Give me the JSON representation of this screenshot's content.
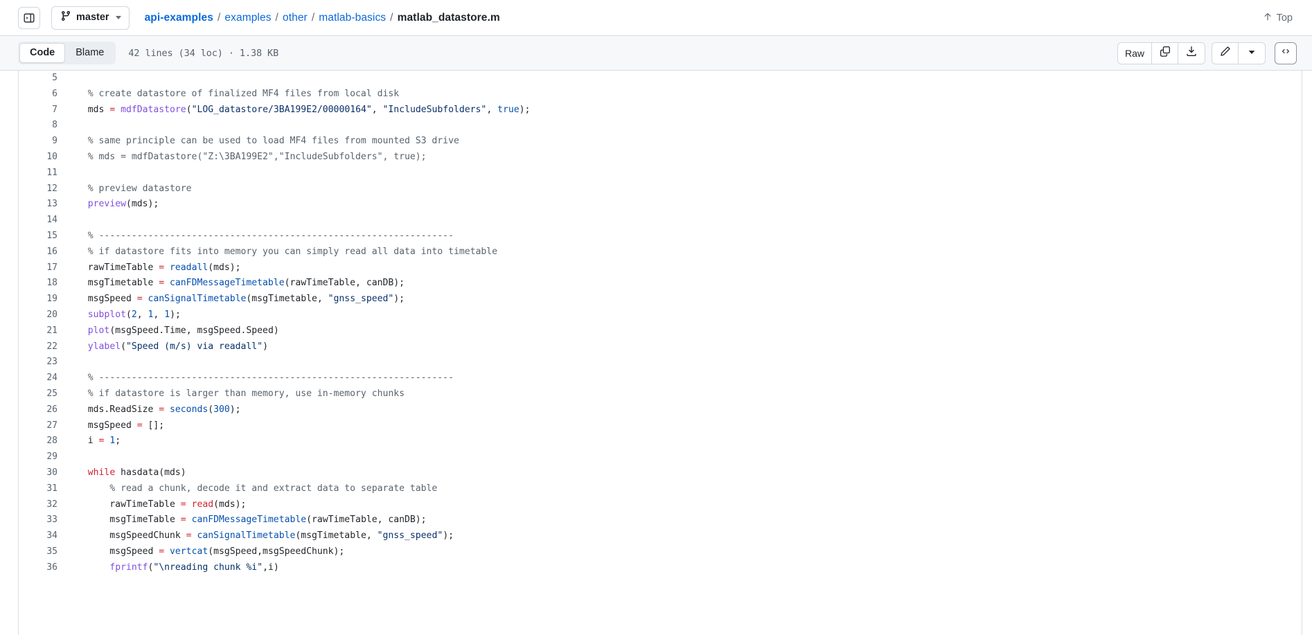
{
  "header": {
    "sidebar_toggle_icon": "sidebar-expand-icon",
    "branch": {
      "icon": "git-branch-icon",
      "name": "master",
      "caret_icon": "chevron-down-icon"
    },
    "breadcrumb": {
      "parts": [
        {
          "label": "api-examples",
          "link": true,
          "bold": true
        },
        {
          "label": "examples",
          "link": true,
          "bold": false
        },
        {
          "label": "other",
          "link": true,
          "bold": false
        },
        {
          "label": "matlab-basics",
          "link": true,
          "bold": false
        }
      ],
      "separator": "/",
      "current": "matlab_datastore.m"
    },
    "top_link": {
      "icon": "arrow-up-icon",
      "label": "Top"
    }
  },
  "toolbar": {
    "tabs": [
      {
        "label": "Code",
        "active": true
      },
      {
        "label": "Blame",
        "active": false
      }
    ],
    "file_meta": "42 lines (34 loc) · 1.38 KB",
    "raw_label": "Raw",
    "copy_icon": "copy-icon",
    "download_icon": "download-icon",
    "edit_icon": "pencil-icon",
    "edit_caret_icon": "chevron-down-icon",
    "symbols_icon": "code-brackets-icon"
  },
  "colors": {
    "link": "#0969da",
    "comment": "#59636e",
    "function_purple": "#8250df",
    "function_blue": "#0550ae",
    "string": "#0a3069",
    "keyword": "#cf222e",
    "border": "#d8dee4",
    "toolbar_bg": "#f6f8fa"
  },
  "code": {
    "language": "matlab",
    "first_visible_line": 5,
    "lines": [
      {
        "n": 5,
        "tokens": []
      },
      {
        "n": 6,
        "tokens": [
          {
            "t": "  ",
            "c": "pun"
          },
          {
            "t": "% create datastore of finalized MF4 files from local disk",
            "c": "com"
          }
        ]
      },
      {
        "n": 7,
        "tokens": [
          {
            "t": "  mds ",
            "c": "id"
          },
          {
            "t": "=",
            "c": "op"
          },
          {
            "t": " ",
            "c": "id"
          },
          {
            "t": "mdfDatastore",
            "c": "fn"
          },
          {
            "t": "(",
            "c": "pun"
          },
          {
            "t": "\"LOG_datastore/3BA199E2/00000164\"",
            "c": "str"
          },
          {
            "t": ", ",
            "c": "pun"
          },
          {
            "t": "\"IncludeSubfolders\"",
            "c": "str"
          },
          {
            "t": ", ",
            "c": "pun"
          },
          {
            "t": "true",
            "c": "bool"
          },
          {
            "t": ");",
            "c": "pun"
          }
        ]
      },
      {
        "n": 8,
        "tokens": []
      },
      {
        "n": 9,
        "tokens": [
          {
            "t": "  ",
            "c": "pun"
          },
          {
            "t": "% same principle can be used to load MF4 files from mounted S3 drive",
            "c": "com"
          }
        ]
      },
      {
        "n": 10,
        "tokens": [
          {
            "t": "  ",
            "c": "pun"
          },
          {
            "t": "% mds = mdfDatastore(\"Z:\\3BA199E2\",\"IncludeSubfolders\", true);",
            "c": "com"
          }
        ]
      },
      {
        "n": 11,
        "tokens": []
      },
      {
        "n": 12,
        "tokens": [
          {
            "t": "  ",
            "c": "pun"
          },
          {
            "t": "% preview datastore",
            "c": "com"
          }
        ]
      },
      {
        "n": 13,
        "tokens": [
          {
            "t": "  ",
            "c": "pun"
          },
          {
            "t": "preview",
            "c": "fn"
          },
          {
            "t": "(mds);",
            "c": "pun"
          }
        ]
      },
      {
        "n": 14,
        "tokens": []
      },
      {
        "n": 15,
        "tokens": [
          {
            "t": "  ",
            "c": "pun"
          },
          {
            "t": "% -----------------------------------------------------------------",
            "c": "com"
          }
        ]
      },
      {
        "n": 16,
        "tokens": [
          {
            "t": "  ",
            "c": "pun"
          },
          {
            "t": "% if datastore fits into memory you can simply read all data into timetable",
            "c": "com"
          }
        ]
      },
      {
        "n": 17,
        "tokens": [
          {
            "t": "  rawTimeTable ",
            "c": "id"
          },
          {
            "t": "=",
            "c": "op"
          },
          {
            "t": " ",
            "c": "id"
          },
          {
            "t": "readall",
            "c": "fn2"
          },
          {
            "t": "(mds);",
            "c": "pun"
          }
        ]
      },
      {
        "n": 18,
        "tokens": [
          {
            "t": "  msgTimetable ",
            "c": "id"
          },
          {
            "t": "=",
            "c": "op"
          },
          {
            "t": " ",
            "c": "id"
          },
          {
            "t": "canFDMessageTimetable",
            "c": "fn2"
          },
          {
            "t": "(rawTimeTable, canDB);",
            "c": "pun"
          }
        ]
      },
      {
        "n": 19,
        "tokens": [
          {
            "t": "  msgSpeed ",
            "c": "id"
          },
          {
            "t": "=",
            "c": "op"
          },
          {
            "t": " ",
            "c": "id"
          },
          {
            "t": "canSignalTimetable",
            "c": "fn2"
          },
          {
            "t": "(msgTimetable, ",
            "c": "pun"
          },
          {
            "t": "\"gnss_speed\"",
            "c": "str"
          },
          {
            "t": ");",
            "c": "pun"
          }
        ]
      },
      {
        "n": 20,
        "tokens": [
          {
            "t": "  ",
            "c": "pun"
          },
          {
            "t": "subplot",
            "c": "fn"
          },
          {
            "t": "(",
            "c": "pun"
          },
          {
            "t": "2",
            "c": "num"
          },
          {
            "t": ", ",
            "c": "pun"
          },
          {
            "t": "1",
            "c": "num"
          },
          {
            "t": ", ",
            "c": "pun"
          },
          {
            "t": "1",
            "c": "num"
          },
          {
            "t": ");",
            "c": "pun"
          }
        ]
      },
      {
        "n": 21,
        "tokens": [
          {
            "t": "  ",
            "c": "pun"
          },
          {
            "t": "plot",
            "c": "fn"
          },
          {
            "t": "(msgSpeed.Time, msgSpeed.Speed)",
            "c": "pun"
          }
        ]
      },
      {
        "n": 22,
        "tokens": [
          {
            "t": "  ",
            "c": "pun"
          },
          {
            "t": "ylabel",
            "c": "fn"
          },
          {
            "t": "(",
            "c": "pun"
          },
          {
            "t": "\"Speed (m/s) via readall\"",
            "c": "str"
          },
          {
            "t": ")",
            "c": "pun"
          }
        ]
      },
      {
        "n": 23,
        "tokens": []
      },
      {
        "n": 24,
        "tokens": [
          {
            "t": "  ",
            "c": "pun"
          },
          {
            "t": "% -----------------------------------------------------------------",
            "c": "com"
          }
        ]
      },
      {
        "n": 25,
        "tokens": [
          {
            "t": "  ",
            "c": "pun"
          },
          {
            "t": "% if datastore is larger than memory, use in-memory chunks",
            "c": "com"
          }
        ]
      },
      {
        "n": 26,
        "tokens": [
          {
            "t": "  mds.ReadSize ",
            "c": "id"
          },
          {
            "t": "=",
            "c": "op"
          },
          {
            "t": " ",
            "c": "id"
          },
          {
            "t": "seconds",
            "c": "fn2"
          },
          {
            "t": "(",
            "c": "pun"
          },
          {
            "t": "300",
            "c": "num"
          },
          {
            "t": ");",
            "c": "pun"
          }
        ]
      },
      {
        "n": 27,
        "tokens": [
          {
            "t": "  msgSpeed ",
            "c": "id"
          },
          {
            "t": "=",
            "c": "op"
          },
          {
            "t": " [];",
            "c": "pun"
          }
        ]
      },
      {
        "n": 28,
        "tokens": [
          {
            "t": "  i ",
            "c": "id"
          },
          {
            "t": "=",
            "c": "op"
          },
          {
            "t": " ",
            "c": "id"
          },
          {
            "t": "1",
            "c": "num"
          },
          {
            "t": ";",
            "c": "pun"
          }
        ]
      },
      {
        "n": 29,
        "tokens": []
      },
      {
        "n": 30,
        "tokens": [
          {
            "t": "  ",
            "c": "pun"
          },
          {
            "t": "while",
            "c": "kw"
          },
          {
            "t": " hasdata(mds)",
            "c": "pun"
          }
        ]
      },
      {
        "n": 31,
        "tokens": [
          {
            "t": "      ",
            "c": "pun"
          },
          {
            "t": "% read a chunk, decode it and extract data to separate table",
            "c": "com"
          }
        ]
      },
      {
        "n": 32,
        "tokens": [
          {
            "t": "      rawTimeTable ",
            "c": "id"
          },
          {
            "t": "=",
            "c": "op"
          },
          {
            "t": " ",
            "c": "id"
          },
          {
            "t": "read",
            "c": "kw"
          },
          {
            "t": "(mds);",
            "c": "pun"
          }
        ]
      },
      {
        "n": 33,
        "tokens": [
          {
            "t": "      msgTimeTable ",
            "c": "id"
          },
          {
            "t": "=",
            "c": "op"
          },
          {
            "t": " ",
            "c": "id"
          },
          {
            "t": "canFDMessageTimetable",
            "c": "fn2"
          },
          {
            "t": "(rawTimeTable, canDB);",
            "c": "pun"
          }
        ]
      },
      {
        "n": 34,
        "tokens": [
          {
            "t": "      msgSpeedChunk ",
            "c": "id"
          },
          {
            "t": "=",
            "c": "op"
          },
          {
            "t": " ",
            "c": "id"
          },
          {
            "t": "canSignalTimetable",
            "c": "fn2"
          },
          {
            "t": "(msgTimetable, ",
            "c": "pun"
          },
          {
            "t": "\"gnss_speed\"",
            "c": "str"
          },
          {
            "t": ");",
            "c": "pun"
          }
        ]
      },
      {
        "n": 35,
        "tokens": [
          {
            "t": "      msgSpeed ",
            "c": "id"
          },
          {
            "t": "=",
            "c": "op"
          },
          {
            "t": " ",
            "c": "id"
          },
          {
            "t": "vertcat",
            "c": "fn2"
          },
          {
            "t": "(msgSpeed,msgSpeedChunk);",
            "c": "pun"
          }
        ]
      },
      {
        "n": 36,
        "tokens": [
          {
            "t": "      ",
            "c": "pun"
          },
          {
            "t": "fprintf",
            "c": "fn"
          },
          {
            "t": "(",
            "c": "pun"
          },
          {
            "t": "\"\\nreading chunk %i\"",
            "c": "str"
          },
          {
            "t": ",i)",
            "c": "pun"
          }
        ]
      }
    ]
  }
}
